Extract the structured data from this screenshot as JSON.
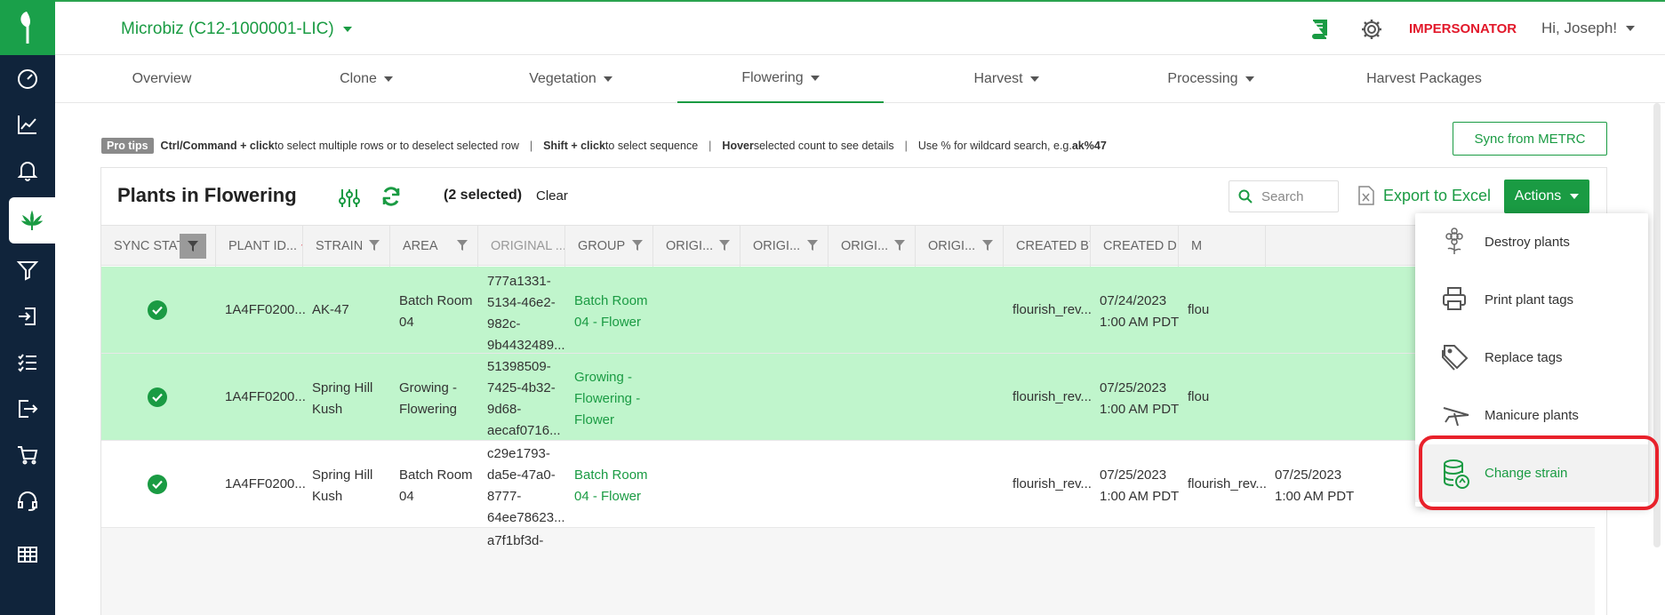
{
  "rail": {
    "items": [
      {
        "icon": "dashboard-icon"
      },
      {
        "icon": "chart-icon"
      },
      {
        "icon": "bell-icon"
      },
      {
        "icon": "cannabis-leaf-icon",
        "active": true
      },
      {
        "icon": "filter-icon"
      },
      {
        "icon": "sign-in-icon"
      },
      {
        "icon": "checklist-icon"
      },
      {
        "icon": "sign-out-icon"
      },
      {
        "icon": "cart-icon"
      },
      {
        "icon": "headset-icon"
      },
      {
        "icon": "table-icon"
      }
    ]
  },
  "header": {
    "company": "Microbiz (C12-1000001-LIC)",
    "impersonator": "IMPERSONATOR",
    "greeting": "Hi, Joseph!"
  },
  "tabs": [
    {
      "label": "Overview",
      "dropdown": false
    },
    {
      "label": "Clone",
      "dropdown": true
    },
    {
      "label": "Vegetation",
      "dropdown": true
    },
    {
      "label": "Flowering",
      "dropdown": true,
      "active": true
    },
    {
      "label": "Harvest",
      "dropdown": true
    },
    {
      "label": "Processing",
      "dropdown": true
    },
    {
      "label": "Harvest Packages",
      "dropdown": false
    }
  ],
  "protips": {
    "badge": "Pro tips",
    "tip1_key": "Ctrl/Command + click",
    "tip1_text": " to select multiple rows or to deselect selected row",
    "tip2_key": "Shift + click",
    "tip2_text": " to select sequence",
    "tip3_key": "Hover",
    "tip3_text": " selected count to see details",
    "tip4_text": "Use % for wildcard search, e.g. ",
    "tip4_key": "ak%47",
    "separator": "|"
  },
  "sync_button": "Sync from METRC",
  "panel": {
    "title": "Plants in Flowering",
    "selected": "(2 selected)",
    "clear": "Clear",
    "search_placeholder": "Search",
    "export": "Export to Excel",
    "actions": "Actions"
  },
  "table": {
    "columns": [
      "SYNC STAT...",
      "PLANT ID...",
      "STRAIN",
      "AREA",
      "ORIGINAL ...",
      "GROUP",
      "ORIGI...",
      "ORIGI...",
      "ORIGI...",
      "ORIGI...",
      "CREATED BY",
      "CREATED D...",
      "M"
    ],
    "sort_arrow": "↑",
    "rows": [
      {
        "selected": true,
        "plant_id": "1A4FF0200...",
        "strain": [
          "AK-47"
        ],
        "area": [
          "Batch Room",
          "04"
        ],
        "original": [
          "777a1331-",
          "5134-46e2-",
          "982c-",
          "9b4432489..."
        ],
        "group": [
          "Batch Room",
          "04 - Flower"
        ],
        "created_by": "flourish_rev...",
        "created_date": [
          "07/24/2023",
          "1:00 AM PDT"
        ],
        "modified_by": "flou"
      },
      {
        "selected": true,
        "plant_id": "1A4FF0200...",
        "strain": [
          "Spring Hill",
          "Kush"
        ],
        "area": [
          "Growing -",
          "Flowering"
        ],
        "original": [
          "51398509-",
          "7425-4b32-",
          "9d68-",
          "aecaf0716..."
        ],
        "group": [
          "Growing -",
          "Flowering -",
          "Flower"
        ],
        "created_by": "flourish_rev...",
        "created_date": [
          "07/25/2023",
          "1:00 AM PDT"
        ],
        "modified_by": "flou"
      },
      {
        "selected": false,
        "plant_id": "1A4FF0200...",
        "strain": [
          "Spring Hill",
          "Kush"
        ],
        "area": [
          "Batch Room",
          "04"
        ],
        "original": [
          "c29e1793-",
          "da5e-47a0-",
          "8777-",
          "64ee78623..."
        ],
        "group": [
          "Batch Room",
          "04 - Flower"
        ],
        "created_by": "flourish_rev...",
        "created_date": [
          "07/25/2023",
          "1:00 AM PDT"
        ],
        "modified_by": "flourish_rev...",
        "modified_date": [
          "07/25/2023",
          "1:00 AM PDT"
        ]
      },
      {
        "selected": false,
        "original": [
          "a7f1bf3d-"
        ]
      }
    ]
  },
  "dropdown": {
    "items": [
      {
        "label": "Destroy plants",
        "icon": "flower-icon"
      },
      {
        "label": "Print plant tags",
        "icon": "printer-icon"
      },
      {
        "label": "Replace tags",
        "icon": "tags-icon"
      },
      {
        "label": "Manicure plants",
        "icon": "scissors-icon"
      },
      {
        "label": "Change strain",
        "icon": "database-swap-icon",
        "highlighted": true
      }
    ]
  },
  "colors": {
    "brand_green": "#1a9b43",
    "selected_row": "#c0f5cc",
    "rail": "#10243b",
    "impersonator_red": "#e2182a",
    "annotation_red": "#e8212b"
  }
}
